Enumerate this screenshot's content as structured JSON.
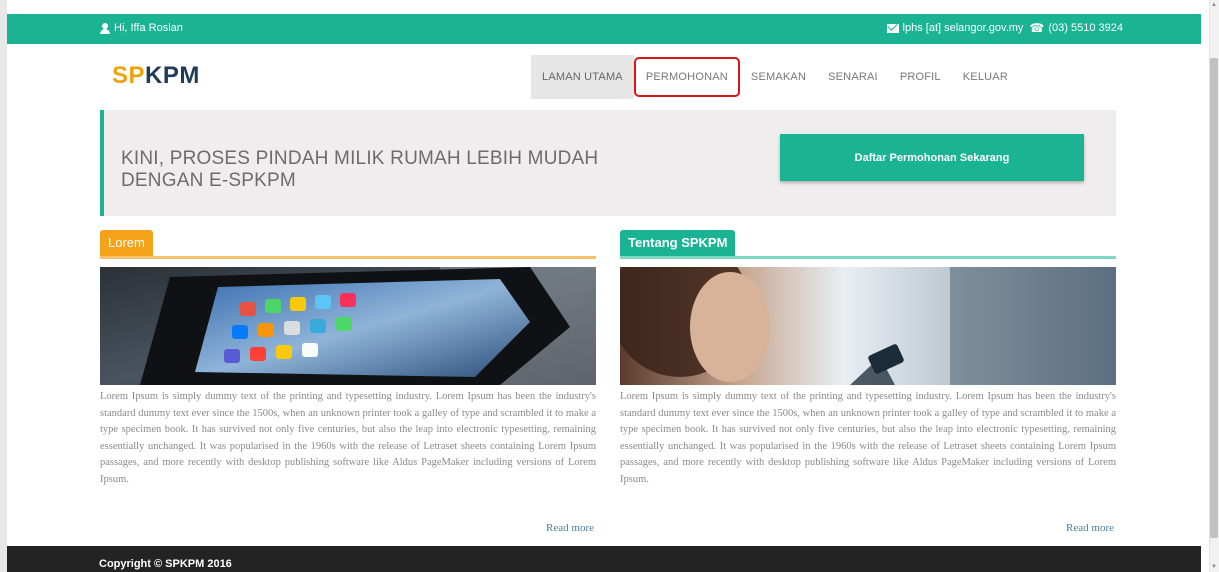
{
  "topbar": {
    "greeting": "Hi, Iffa Roslan",
    "email": "lphs [at] selangor.gov.my",
    "phone": "(03) 5510 3924",
    "bg_color": "#1ab394"
  },
  "logo": {
    "part1": "SP",
    "part2": "KPM"
  },
  "nav": {
    "items": [
      {
        "label": "LAMAN UTAMA"
      },
      {
        "label": "PERMOHONAN"
      },
      {
        "label": "SEMAKAN"
      },
      {
        "label": "SENARAI"
      },
      {
        "label": "PROFIL"
      },
      {
        "label": "KELUAR"
      }
    ]
  },
  "banner": {
    "title": "KINI, PROSES PINDAH MILIK RUMAH LEBIH MUDAH DENGAN E-SPKPM",
    "button": "Daftar Permohonan Sekarang"
  },
  "columns": {
    "left": {
      "tab": "Lorem",
      "text": "Lorem Ipsum is simply dummy text of the printing and typesetting industry. Lorem Ipsum has been the industry's standard dummy text ever since the 1500s, when an unknown printer took a galley of type and scrambled it to make a type specimen book. It has survived not only five centuries, but also the leap into electronic typesetting, remaining essentially unchanged. It was popularised in the 1960s with the release of Letraset sheets containing Lorem Ipsum passages, and more recently with desktop publishing software like Aldus PageMaker including versions of Lorem Ipsum.",
      "read_more": "Read more"
    },
    "right": {
      "tab": "Tentang SPKPM",
      "text": "Lorem Ipsum is simply dummy text of the printing and typesetting industry. Lorem Ipsum has been the industry's standard dummy text ever since the 1500s, when an unknown printer took a galley of type and scrambled it to make a type specimen book. It has survived not only five centuries, but also the leap into electronic typesetting, remaining essentially unchanged. It was popularised in the 1960s with the release of Letraset sheets containing Lorem Ipsum passages, and more recently with desktop publishing software like Aldus PageMaker including versions of Lorem Ipsum.",
      "read_more": "Read more"
    }
  },
  "footer": {
    "copyright": "Copyright © SPKPM 2016"
  }
}
